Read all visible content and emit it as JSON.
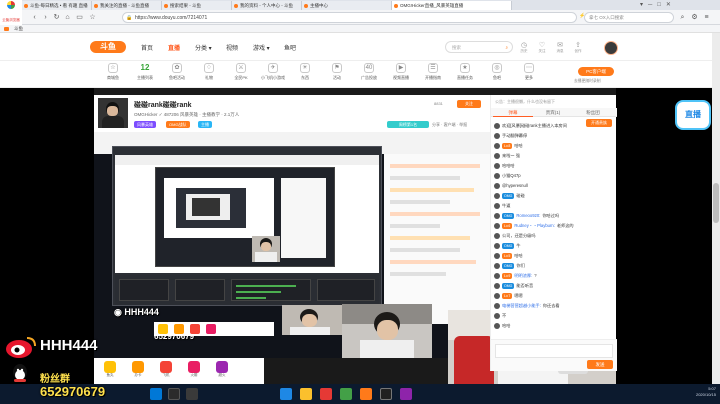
{
  "browser": {
    "tabs": [
      {
        "label": "斗鱼-每日精选 • 看 有趣 直播",
        "color": "#ff7a1a",
        "active": false
      },
      {
        "label": "我关注的直播 - 斗鱼直播",
        "color": "#ff7a1a",
        "active": false
      },
      {
        "label": "搜索结果 - 斗鱼",
        "color": "#ff7a1a",
        "active": false
      },
      {
        "label": "我的资料 - 个人中心 - 斗鱼",
        "color": "#ff7a1a",
        "active": false
      },
      {
        "label": "主播中心",
        "color": "#ff7a1a",
        "active": false
      },
      {
        "label": "OMG!Hicker直播_风暴英雄直播",
        "color": "#ff7a1a",
        "active": true
      }
    ],
    "url": "https://www.douyu.com/7214071",
    "search_placeholder": "拿七 OX入口搜索",
    "bookmarks": [
      "斗鱼"
    ],
    "browser_name": "云聚浏览器"
  },
  "site": {
    "logo": "斗鱼",
    "nav": [
      "首页",
      "直播",
      "分类",
      "视频",
      "游戏",
      "鱼吧"
    ],
    "search_placeholder": "搜索",
    "header_icons": [
      {
        "icon": "history-icon",
        "glyph": "◷",
        "label": "历史"
      },
      {
        "icon": "follow-icon",
        "glyph": "♡",
        "label": "关注"
      },
      {
        "icon": "message-icon",
        "glyph": "✉",
        "label": "消息"
      },
      {
        "icon": "upload-icon",
        "glyph": "⇪",
        "label": "创作"
      }
    ]
  },
  "categories": [
    {
      "label": "商城鱼",
      "glyph": "☆"
    },
    {
      "label": "主播列表",
      "glyph": "12"
    },
    {
      "label": "鱼吧活动",
      "glyph": "✿"
    },
    {
      "label": "礼物",
      "glyph": "♢"
    },
    {
      "label": "全民PK",
      "glyph": "⚔"
    },
    {
      "label": "小飞机小游戏",
      "glyph": "✈"
    },
    {
      "label": "东西",
      "glyph": "☀"
    },
    {
      "label": "活动",
      "glyph": "⚑"
    },
    {
      "label": "广告投放",
      "glyph": "40"
    },
    {
      "label": "视频直播",
      "glyph": "▶"
    },
    {
      "label": "开播指南",
      "glyph": "☰"
    },
    {
      "label": "直播任务",
      "glyph": "★"
    },
    {
      "label": "鱼吧",
      "glyph": "◎"
    },
    {
      "label": "更多",
      "glyph": "⋯"
    }
  ],
  "pc_client": {
    "label": "PC客户端",
    "sub": "去播更随时录制"
  },
  "room": {
    "title": "碰碰rank碰碰rank",
    "meta": "OMGHicker ✓ 487206   风暴英雄  ·  主播教学  ·  2.1万人",
    "tag1": "风暴英雄",
    "tag2": "OMG战队",
    "tag3": "主播",
    "rank": "周榜第1名",
    "hot": "8831",
    "follow": "关注",
    "side_tags": [
      "分享",
      "客户端",
      "举报"
    ]
  },
  "chat": {
    "notice": "公告：主播很懒，什么也没有留下",
    "tabs": [
      "弹幕",
      "贵宾(1)",
      "粉丝团"
    ],
    "messages": [
      {
        "badge": "",
        "badge_color": "#888",
        "name": "",
        "text": "欢迎[风暴]碰碰rank主播进入本房间"
      },
      {
        "badge": "",
        "badge_color": "#1aa0ff",
        "name": "",
        "text": "手动翻弹幕停"
      },
      {
        "badge": "Lv.8",
        "badge_color": "#ff7a1a",
        "name": "",
        "text": "哈哈"
      },
      {
        "badge": "",
        "badge_color": "#888",
        "name": "",
        "text": "来啦～ 强"
      },
      {
        "badge": "",
        "badge_color": "#888",
        "name": "",
        "text": "哈哈哈"
      },
      {
        "badge": "",
        "badge_color": "#888",
        "name": "",
        "text": "小猫Q47p"
      },
      {
        "badge": "",
        "badge_color": "#888",
        "name": "",
        "text": "@hyperesnull"
      },
      {
        "badge": "OMG",
        "badge_color": "#1b8dde",
        "name": "",
        "text": "碰碰"
      },
      {
        "badge": "",
        "badge_color": "#888",
        "name": "",
        "text": "牛逼"
      },
      {
        "badge": "OMG",
        "badge_color": "#1b8dde",
        "name": "Romeoo920:",
        "text": "你哈过吗"
      },
      {
        "badge": "Lv.6",
        "badge_color": "#ff7a1a",
        "name": "Rudney・・Playburn:",
        "text": "老师这的"
      },
      {
        "badge": "",
        "badge_color": "#888",
        "name": "",
        "text": "公司，还是分级吗"
      },
      {
        "badge": "OMG",
        "badge_color": "#1b8dde",
        "name": "",
        "text": "牛"
      },
      {
        "badge": "Lv.5",
        "badge_color": "#ff7a1a",
        "name": "",
        "text": "哈哈"
      },
      {
        "badge": "OMG",
        "badge_color": "#1b8dde",
        "name": "",
        "text": "你们"
      },
      {
        "badge": "Lv.9",
        "badge_color": "#ff7a1a",
        "name": "明明浓厚:",
        "text": "?"
      },
      {
        "badge": "OMG",
        "badge_color": "#1b8dde",
        "name": "",
        "text": "能否听音"
      },
      {
        "badge": "Lv.7",
        "badge_color": "#ff7a1a",
        "name": "",
        "text": "嗯嗯"
      },
      {
        "badge": "",
        "badge_color": "#888",
        "name": "电梯营营超越小能手:",
        "text": "你还去看"
      },
      {
        "badge": "",
        "badge_color": "#888",
        "name": "",
        "text": "不"
      },
      {
        "badge": "",
        "badge_color": "#888",
        "name": "",
        "text": "哈哈"
      }
    ],
    "send_label": "发送"
  },
  "gifts": [
    {
      "label": "鱼丸",
      "color": "#ffc107"
    },
    {
      "label": "办卡",
      "color": "#ff9800"
    },
    {
      "label": "飞机",
      "color": "#f44336"
    },
    {
      "label": "火箭",
      "color": "#e91e63"
    },
    {
      "label": "超火",
      "color": "#9c27b0"
    }
  ],
  "overlay": {
    "weibo_name": "HHH444",
    "weibo_label_small": "HHH444",
    "qq_group_label": "粉丝群",
    "qq_number": "652970679",
    "qq_number_small": "652970679"
  },
  "mascot": "直播",
  "taskbar": {
    "time": "5:07",
    "date": "2020/10/15"
  }
}
